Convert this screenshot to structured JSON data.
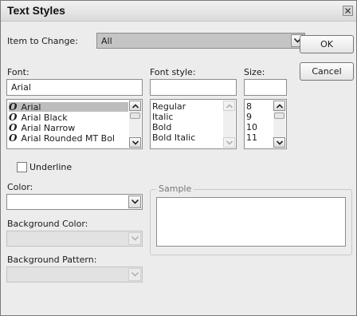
{
  "dialog": {
    "title": "Text Styles"
  },
  "item_to_change": {
    "label": "Item to Change:",
    "value": "All"
  },
  "buttons": {
    "ok": "OK",
    "cancel": "Cancel"
  },
  "font": {
    "label": "Font:",
    "value": "Arial",
    "items": [
      "Arial",
      "Arial Black",
      "Arial Narrow",
      "Arial Rounded MT Bol"
    ],
    "selected": "Arial"
  },
  "font_style": {
    "label": "Font style:",
    "value": "",
    "items": [
      "Regular",
      "Italic",
      "Bold",
      "Bold Italic"
    ]
  },
  "size": {
    "label": "Size:",
    "value": "",
    "items": [
      "8",
      "9",
      "10",
      "11"
    ]
  },
  "underline": {
    "label": "Underline",
    "checked": false
  },
  "color": {
    "label": "Color:",
    "value": ""
  },
  "sample": {
    "label": "Sample"
  },
  "background_color": {
    "label": "Background Color:",
    "value": ""
  },
  "background_pattern": {
    "label": "Background Pattern:",
    "value": ""
  }
}
